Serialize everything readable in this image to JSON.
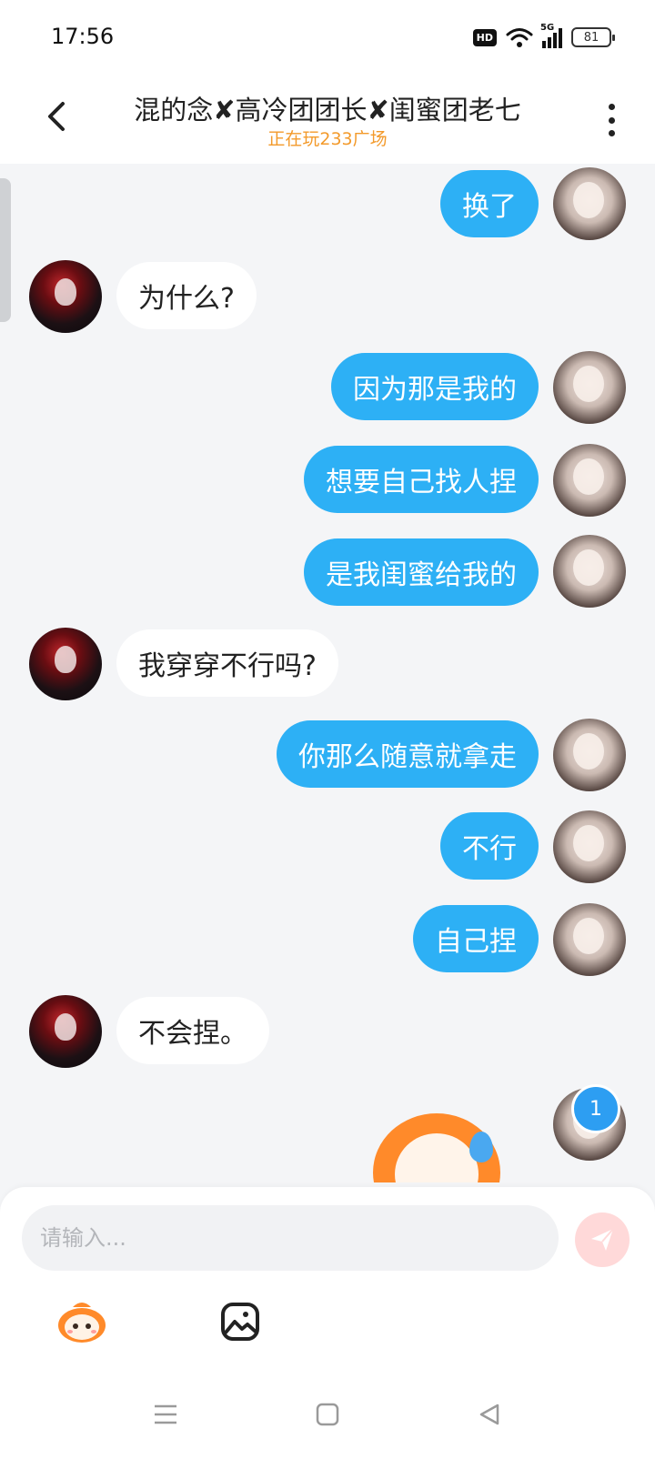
{
  "status": {
    "time": "17:56",
    "hd": "HD",
    "network": "5G",
    "battery": "81"
  },
  "header": {
    "title": "混的念✘高冷团团长✘闺蜜团老七",
    "subtitle": "正在玩233广场"
  },
  "messages": [
    {
      "from": "me",
      "text": "换了"
    },
    {
      "from": "other",
      "text": "为什么?"
    },
    {
      "from": "me",
      "text": "因为那是我的"
    },
    {
      "from": "me",
      "text": "想要自己找人捏"
    },
    {
      "from": "me",
      "text": "是我闺蜜给我的"
    },
    {
      "from": "other",
      "text": "我穿穿不行吗?"
    },
    {
      "from": "me",
      "text": "你那么随意就拿走"
    },
    {
      "from": "me",
      "text": "不行"
    },
    {
      "from": "me",
      "text": "自己捏"
    },
    {
      "from": "other",
      "text": "不会捏。"
    }
  ],
  "unread_count": "1",
  "composer": {
    "placeholder": "请输入..."
  },
  "colors": {
    "my_bubble": "#2db0f5",
    "other_bubble": "#ffffff",
    "subtitle": "#f39a2b",
    "send_disabled": "#ffd9d9"
  },
  "icons": [
    "back-arrow-icon",
    "more-icon",
    "wifi-icon",
    "signal-icon",
    "battery-icon",
    "send-icon",
    "emoji-mascot-icon",
    "image-icon",
    "menu-icon",
    "home-icon",
    "back-triangle-icon"
  ]
}
